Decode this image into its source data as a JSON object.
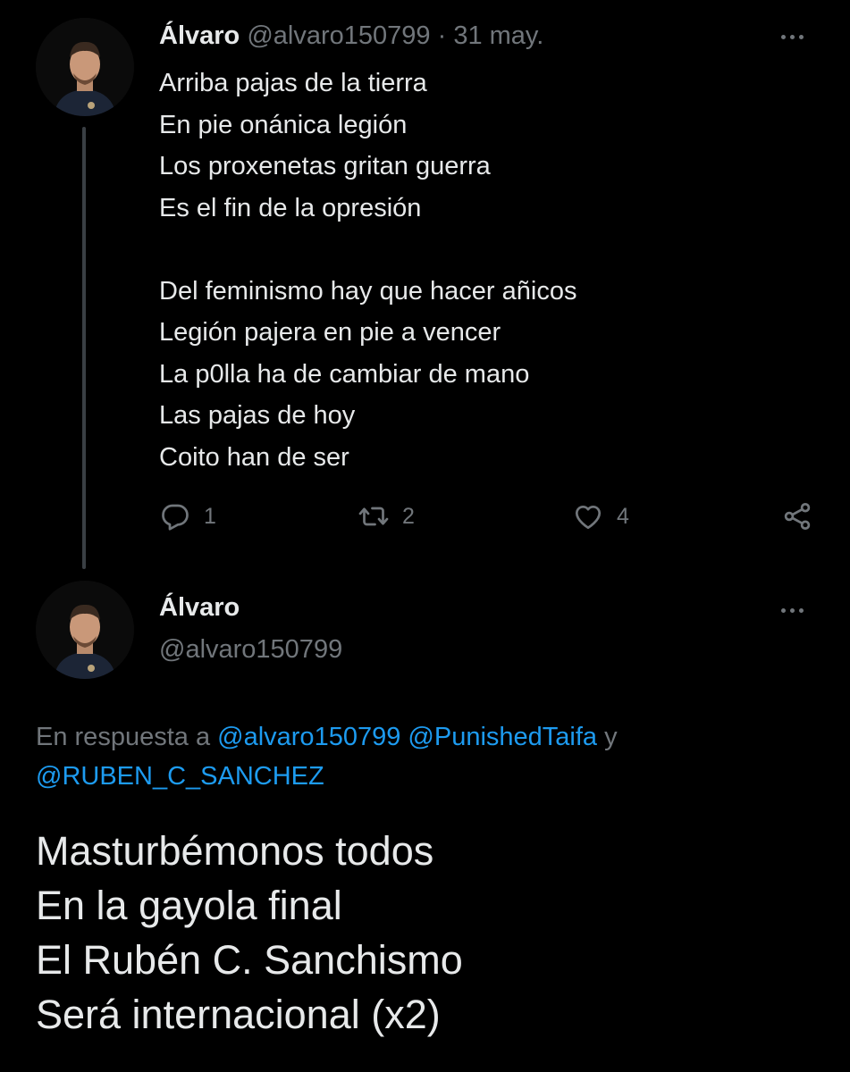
{
  "tweet1": {
    "author_name": "Álvaro",
    "handle": "@alvaro150799",
    "separator": "·",
    "date": "31 may.",
    "body_lines": [
      "Arriba pajas de la tierra",
      "En pie onánica legión",
      "Los proxenetas gritan guerra",
      "Es el fin de la opresión",
      "",
      "Del feminismo hay que hacer añicos",
      "Legión pajera en pie a vencer",
      "La p0lla ha de cambiar de mano",
      "Las pajas de hoy",
      "Coito han de ser"
    ],
    "actions": {
      "reply_count": "1",
      "retweet_count": "2",
      "like_count": "4"
    }
  },
  "tweet2": {
    "author_name": "Álvaro",
    "handle": "@alvaro150799",
    "reply_prefix": "En respuesta a ",
    "reply_mentions": [
      "@alvaro150799",
      "@PunishedTaifa",
      "@RUBEN_C_SANCHEZ"
    ],
    "reply_conjunction": " y",
    "body_lines": [
      "Masturbémonos todos",
      "En la gayola final",
      "El Rubén C. Sanchismo",
      "Será internacional (x2)"
    ]
  },
  "icons": {
    "more": "more-horizontal-icon",
    "reply": "reply-icon",
    "retweet": "retweet-icon",
    "like": "heart-icon",
    "share": "share-icon"
  },
  "colors": {
    "background": "#000000",
    "text_primary": "#e7e9ea",
    "text_secondary": "#71767b",
    "link": "#1d9bf0",
    "thread_line": "#3a3f44"
  }
}
